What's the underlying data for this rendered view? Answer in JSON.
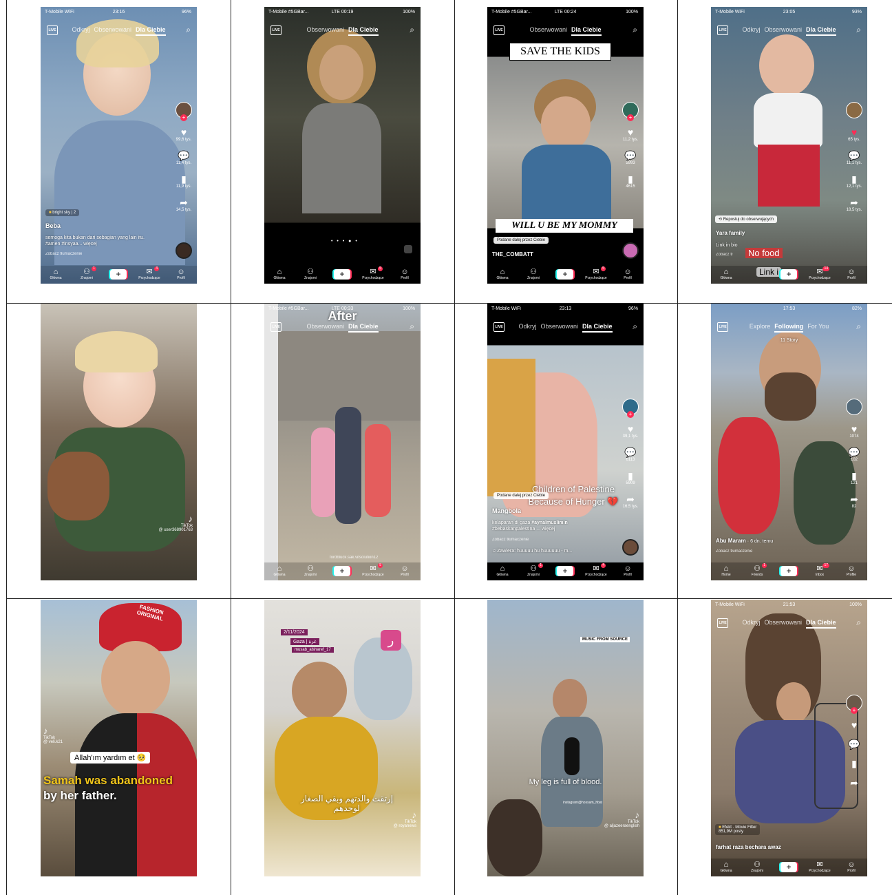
{
  "nav_pl": {
    "odkryj": "Odkryj",
    "obserwowani": "Obserwowani",
    "dla_ciebie": "Dla Ciebie",
    "live": "LIVE"
  },
  "bottom_pl": {
    "glowna": "Główna",
    "znajomi": "Znajomi",
    "przychodzace": "Przychodzące",
    "profil": "Profil"
  },
  "bottom_en": {
    "home": "Home",
    "friends": "Friends",
    "inbox": "Inbox",
    "profile": "Profile"
  },
  "nav_en": {
    "explore": "Explore",
    "following": "Following",
    "for_you": "For You"
  },
  "tiktok_label": "TikTok",
  "shots": {
    "s1": {
      "carrier": "T-Mobile WiFi",
      "time": "23:16",
      "battery": "96%",
      "likes": "99,6 tys.",
      "comments": "11,4 tys.",
      "saves": "11,9 tys.",
      "shares": "14,5 tys.",
      "sound": "bright sky",
      "sound_count": "2",
      "author": "Beba",
      "caption": "semoga kita bukan dari sebagian yang lain itu. #amen #insyaa... więcej",
      "translate": "Zobacz tłumaczenie",
      "badge_friends": "1",
      "badge_inbox": "4"
    },
    "s2": {
      "carrier": "T-Mobile #5GBar...",
      "net": "LTE",
      "time": "00:19",
      "battery": "100%",
      "badge_inbox": "5"
    },
    "s3": {
      "carrier": "T-Mobile #5GBar...",
      "net": "LTE",
      "time": "00:24",
      "battery": "100%",
      "banner": "SAVE THE KIDS",
      "likes": "11,2 tys.",
      "comments": "5993",
      "saves": "4615",
      "overlay": "WILL U BE MY MOMMY",
      "repost": "Podane dalej przez Ciebie",
      "author": "THE_COMBATT",
      "badge_inbox": "5"
    },
    "s4": {
      "carrier": "T-Mobile WiFi",
      "time": "23:05",
      "battery": "93%",
      "likes": "65 tys.",
      "comments": "11,1 tys.",
      "saves": "12,1 tys.",
      "shares": "18,5 tys.",
      "repost": "Repostuj do obserwujących",
      "author": "Yara family",
      "caption": "Link in bio",
      "food": "No food",
      "link": "Link i",
      "translate": "Zobacz tł",
      "badge_inbox": "14"
    },
    "s5": {
      "watermark": "@ user368901763"
    },
    "s6": {
      "carrier": "T-Mobile #5GBar...",
      "net": "LTE",
      "time": "00:33",
      "battery": "100%",
      "overlay": "After",
      "handle": "fordbluck.sak.vitsolution12",
      "badge_inbox": "5"
    },
    "s7": {
      "carrier": "T-Mobile WiFi",
      "time": "23:13",
      "battery": "96%",
      "overlay1": "Children of Palestine",
      "overlay2": "Because of Hunger",
      "likes": "39,1 tys.",
      "comments": "6113",
      "saves": "5909",
      "shares": "16,5 tys.",
      "repost": "Podane dalej przez Ciebie",
      "author": "Mangbola",
      "caption1": "kelaparan di gaza",
      "tag1": "#aynalmuslimin",
      "caption2": "#bebaskanpalestina ... więcej",
      "translate": "Zobacz tłumaczenie",
      "music": "Zawiera: huuuuu hu huuuuuu - m...",
      "badge_friends": "1",
      "badge_inbox": "4"
    },
    "s8": {
      "time": "17:53",
      "battery": "82%",
      "story": "11 Story",
      "likes": "1074",
      "comments": "102",
      "saves": "121",
      "shares": "82",
      "author": "Abu Maram",
      "ago": "· 6 dn. temu",
      "translate": "Zobacz tłumaczenie",
      "badge_friends": "1",
      "badge_inbox": "17"
    },
    "s9": {
      "cap_text": "FASHION ORIGINAL",
      "handle": "@ veli.k21",
      "bubble": "Allah'ım yardım et",
      "line1": "Samah was abandoned",
      "line2": "by her father."
    },
    "s10": {
      "date": "2/11/2024",
      "loc": "Gaza | غزة",
      "user": "musab_alsharef_17",
      "arabic": "إرتقت والدتهم وبقي الصغار لوحدهم",
      "handle": "@ royanews"
    },
    "s11": {
      "tag": "MUSIC FROM SOURCE",
      "subtitle": "My leg is full of blood.",
      "ig": "instagram@hossam_hbat",
      "handle": "@ aljazeeraenglish"
    },
    "s12": {
      "carrier": "T-Mobile WiFi",
      "time": "21:53",
      "battery": "100%",
      "effect": "Efekt · Movie Filter",
      "posts": "851,9M posty",
      "author": "farhat raza bechara awaz"
    }
  }
}
